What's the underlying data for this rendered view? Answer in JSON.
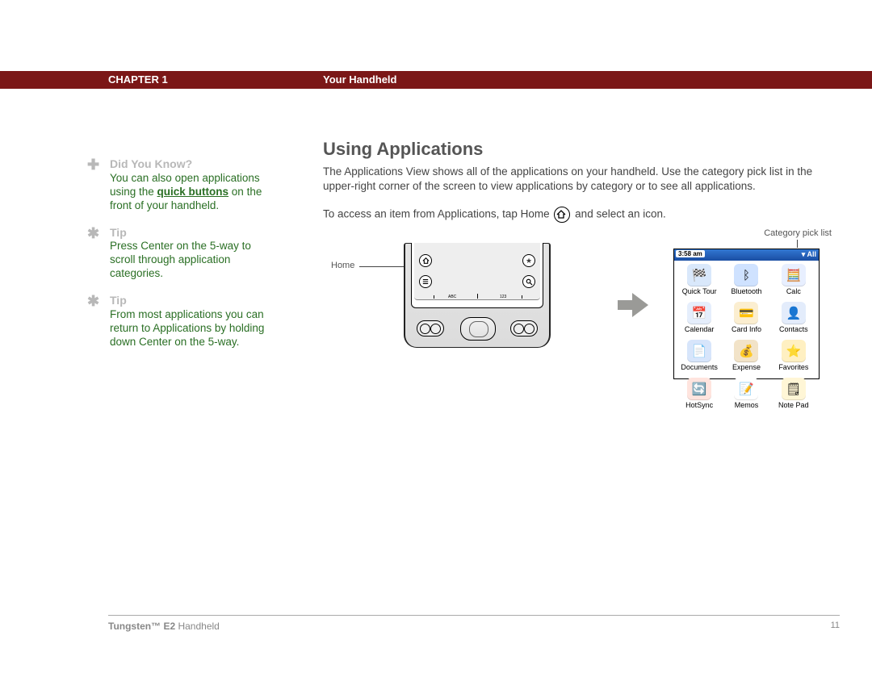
{
  "header": {
    "chapter_label": "CHAPTER 1",
    "book_section": "Your Handheld"
  },
  "section": {
    "title": "Using Applications",
    "para1": "The Applications View shows all of the applications on your handheld. Use the category pick list in the upper-right corner of the screen to view applications by category or to see all applications.",
    "para2_before": "To access an item from Applications, tap Home",
    "para2_after": "and select an icon."
  },
  "sidebar": {
    "did_you_know": {
      "head": "Did You Know?",
      "t1": "You can also open applications using the ",
      "link": "quick buttons",
      "t2": " on the front of your handheld."
    },
    "tip1": {
      "head": "Tip",
      "body": "Press Center on the 5-way to scroll through application categories."
    },
    "tip2": {
      "head": "Tip",
      "body": "From most applications you can return to Applications by holding down Center on the 5-way."
    }
  },
  "callouts": {
    "home": "Home",
    "picklist": "Category pick list"
  },
  "device": {
    "screen_text_left": "ABC",
    "screen_text_right": "123"
  },
  "screenshot": {
    "time": "3:58 am",
    "pick_label": "All",
    "apps": [
      {
        "label": "Quick Tour",
        "bg": "#d9e8fb",
        "glyph": "🏁"
      },
      {
        "label": "Bluetooth",
        "bg": "#cfe2ff",
        "glyph": "ᛒ"
      },
      {
        "label": "Calc",
        "bg": "#e8efff",
        "glyph": "🧮"
      },
      {
        "label": "Calendar",
        "bg": "#e5eefc",
        "glyph": "📅"
      },
      {
        "label": "Card Info",
        "bg": "#fbeed0",
        "glyph": "💳"
      },
      {
        "label": "Contacts",
        "bg": "#e3ecfb",
        "glyph": "👤"
      },
      {
        "label": "Documents",
        "bg": "#d7e5fb",
        "glyph": "📄"
      },
      {
        "label": "Expense",
        "bg": "#f2e3c8",
        "glyph": "💰"
      },
      {
        "label": "Favorites",
        "bg": "#fff0c2",
        "glyph": "⭐"
      },
      {
        "label": "HotSync",
        "bg": "#ffe4de",
        "glyph": "🔄"
      },
      {
        "label": "Memos",
        "bg": "#ffffff",
        "glyph": "📝"
      },
      {
        "label": "Note Pad",
        "bg": "#fff6d6",
        "glyph": "🗒"
      }
    ]
  },
  "footer": {
    "product_strong": "Tungsten™ E2",
    "product_rest": " Handheld",
    "page": "11"
  }
}
